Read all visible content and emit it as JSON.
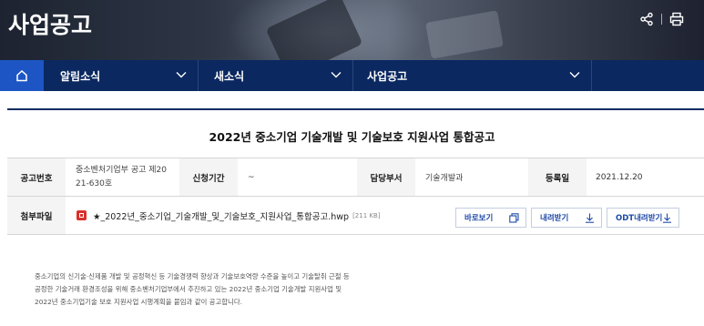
{
  "hero": {
    "title": "사업공고"
  },
  "nav": {
    "items": [
      {
        "label": "알림소식"
      },
      {
        "label": "새소식"
      },
      {
        "label": "사업공고"
      }
    ]
  },
  "notice": {
    "title": "2022년 중소기업 기술개발 및 기술보호 지원사업 통합공고",
    "fields": {
      "number_label": "공고번호",
      "number_value_1": "중소벤처기업부 공고 제20",
      "number_value_2": "21-630호",
      "period_label": "신청기간",
      "period_value": "~",
      "dept_label": "담당부서",
      "dept_value": "기술개발과",
      "date_label": "등록일",
      "date_value": "2021.12.20"
    },
    "attachment": {
      "label": "첨부파일",
      "filename": "★_2022년_중소기업_기술개발_및_기술보호_지원사업_통합공고.hwp",
      "size": "[211 KB]",
      "view_label": "바로보기",
      "download_label": "내려받기",
      "odt_label": "ODT내려받기"
    },
    "description": [
      "중소기업의 신기술·신제품 개발 및 공정혁신 등 기술경쟁력 향상과 기술보호역량 수준을 높이고 기술탈취 근절 등",
      "공정한 기술거래 환경조성을 위해 중소벤처기업부에서 추진하고 있는 2022년 중소기업 기술개발 지원사업 및",
      "2022년 중소기업기술 보호 지원사업 시행계획을 붙임과 같이 공고합니다."
    ]
  },
  "colors": {
    "nav_bg": "#0b2860",
    "home_bg": "#1d56c4",
    "accent": "#1f4aa8",
    "hwp_icon": "#d9302b"
  },
  "icons": [
    "home-icon",
    "share-icon",
    "print-icon",
    "chevron-down-icon",
    "hwp-file-icon",
    "copy-icon",
    "download-icon"
  ]
}
